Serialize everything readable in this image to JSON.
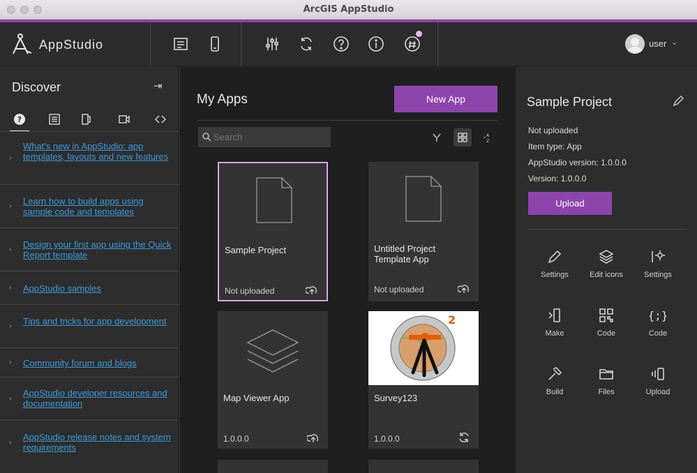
{
  "window": {
    "title": "ArcGIS AppStudio"
  },
  "toolbar": {
    "brand": "AppStudio",
    "user_name": "user",
    "accent_color": "#8b43a6",
    "icons": [
      "app-details-icon",
      "preview-device-icon",
      "settings-sliders-icon",
      "sync-icon",
      "help-icon",
      "info-icon",
      "feedback-icon"
    ]
  },
  "left_panel": {
    "title": "Discover",
    "tabs": [
      "help-icon",
      "news-icon",
      "release-icon",
      "video-icon",
      "share-icon"
    ],
    "news": [
      {
        "label": "What's new in AppStudio: app templates, layouts and new features"
      },
      {
        "label": "Learn how to build apps using sample code and templates"
      },
      {
        "label": "Design your first app using the Quick Report template"
      },
      {
        "label": "AppStudio samples"
      },
      {
        "label": "Tips and tricks for app development"
      },
      {
        "label": "Community forum and blogs"
      },
      {
        "label": "AppStudio developer resources and documentation"
      },
      {
        "label": "AppStudio release notes and system requirements"
      }
    ]
  },
  "main": {
    "title": "My Apps",
    "new_app_button": "New App",
    "search_placeholder": "Search",
    "apps": [
      {
        "name": "Sample Project",
        "meta": "Not uploaded",
        "action": "upload-icon",
        "thumb": "document-icon",
        "selected": true
      },
      {
        "name": "Untitled Project Template App",
        "meta": "Not uploaded",
        "action": "upload-icon",
        "thumb": "document-icon",
        "selected": false
      },
      {
        "name": "Map Viewer App",
        "meta": "1.0.0.0",
        "action": "upload-icon",
        "thumb": "layers-icon",
        "selected": false
      },
      {
        "name": "Survey123",
        "meta": "1.0.0.0",
        "action": "sync-icon",
        "thumb": "survey-logo",
        "selected": false
      }
    ]
  },
  "details": {
    "title": "Sample Project",
    "info": [
      "Not uploaded",
      "Item type: App",
      "AppStudio version: 1.0.0.0",
      "Version: 1.0.0.0"
    ],
    "upload_button": "Upload",
    "tools": [
      {
        "label": "Settings",
        "icon": "pencil-icon"
      },
      {
        "label": "Edit icons",
        "icon": "layers-icon"
      },
      {
        "label": "Settings",
        "icon": "gear-icon"
      },
      {
        "label": "Make",
        "icon": "run-icon"
      },
      {
        "label": "Code",
        "icon": "qr-code-icon"
      },
      {
        "label": "Code",
        "icon": "braces-icon"
      },
      {
        "label": "Build",
        "icon": "hammer-icon"
      },
      {
        "label": "Files",
        "icon": "folder-icon"
      },
      {
        "label": "Upload",
        "icon": "devices-icon"
      }
    ]
  }
}
